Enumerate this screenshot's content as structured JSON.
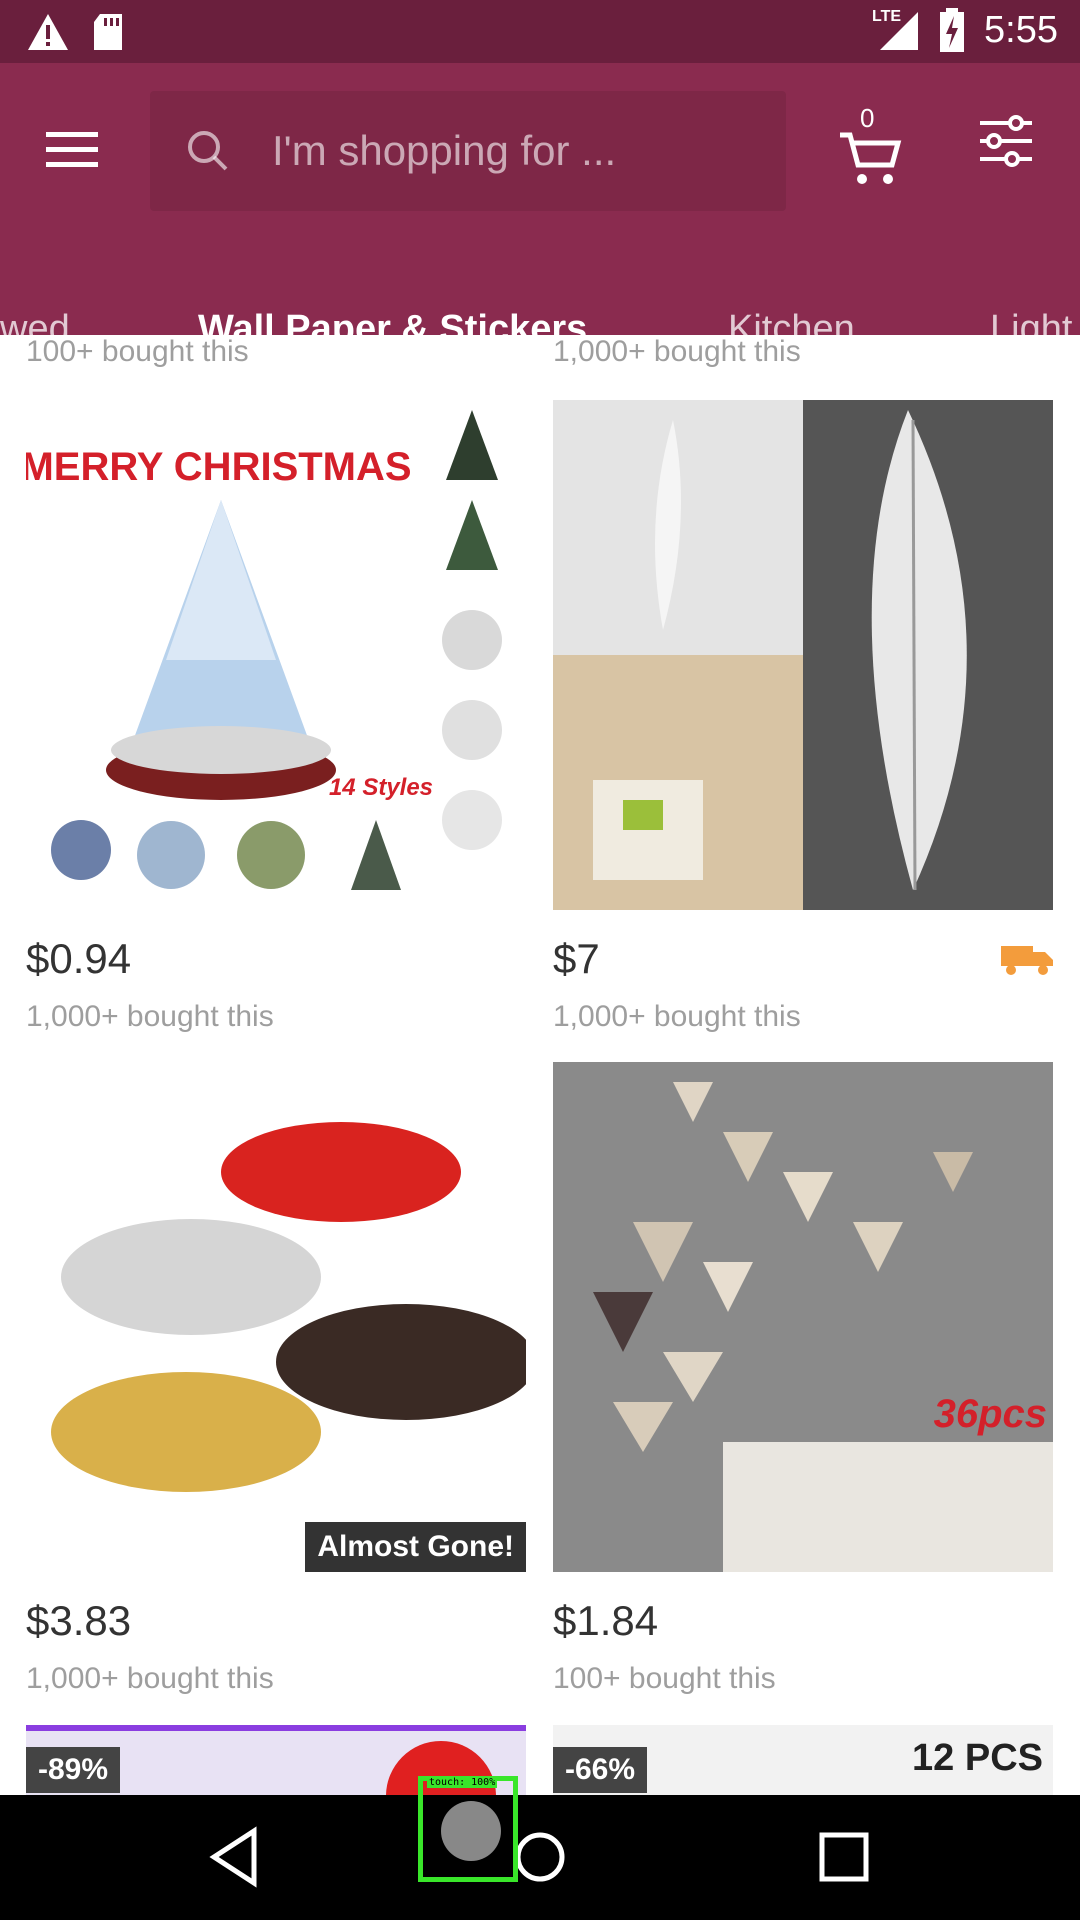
{
  "status_bar": {
    "time": "5:55",
    "network": "LTE",
    "icons": [
      "warning-icon",
      "sd-card-icon",
      "signal-icon",
      "battery-charging-icon"
    ]
  },
  "header": {
    "search_placeholder": "I'm shopping for ...",
    "cart_count": "0"
  },
  "tabs": [
    {
      "label": "wed",
      "active": false
    },
    {
      "label": "Wall Paper & Stickers",
      "active": true
    },
    {
      "label": "Kitchen",
      "active": false
    },
    {
      "label": "Light",
      "active": false
    }
  ],
  "top_row": {
    "left_bought": "100+ bought this",
    "right_bought": "1,000+ bought this"
  },
  "products": [
    {
      "price": "$0.94",
      "bought": "1,000+ bought this",
      "image_text": "MERRY CHRISTMAS",
      "badge": "14 Styles"
    },
    {
      "price": "$7",
      "bought": "1,000+ bought this",
      "shipping_icon": "truck-icon"
    },
    {
      "price": "$3.83",
      "bought": "1,000+ bought this",
      "overlay": "Almost Gone!"
    },
    {
      "price": "$1.84",
      "bought": "100+ bought this",
      "badge": "36pcs"
    }
  ],
  "bottom_row": {
    "left_discount": "-89%",
    "right_discount": "-66%",
    "right_label": "12 PCS"
  },
  "touch_indicator": "touch: 100%",
  "colors": {
    "status_bar": "#6a1f3d",
    "app_bar": "#8a2b4f",
    "accent_orange": "#f39c3c"
  }
}
